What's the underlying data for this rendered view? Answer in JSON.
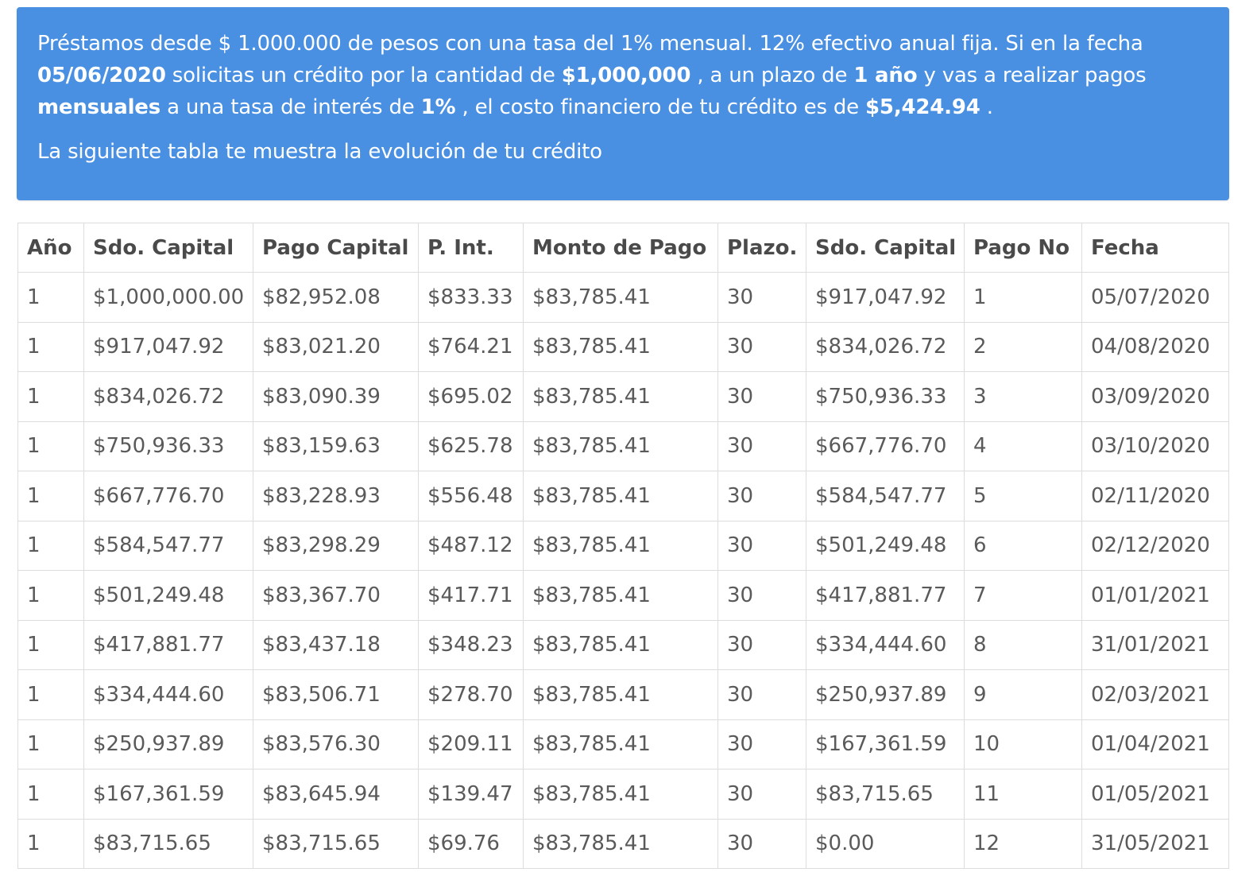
{
  "info": {
    "p1": "Préstamos desde $ 1.000.000 de pesos con una tasa del 1% mensual. 12% efectivo anual fija. Si en la fecha ",
    "date": "05/06/2020",
    "p2": " solicitas un crédito por la cantidad de ",
    "amount": "$1,000,000",
    "p3": " , a un plazo de ",
    "term": "1 año",
    "p4": " y vas a realizar pagos ",
    "frequency": "mensuales",
    "p5": " a una tasa de interés de ",
    "rate": "1%",
    "p6": " , el costo financiero de tu crédito es de ",
    "cost": "$5,424.94",
    "p7": " .",
    "subtitle": "La siguiente tabla te muestra la evolución de tu crédito"
  },
  "table": {
    "headers": [
      "Año",
      "Sdo. Capital",
      "Pago Capital",
      "P. Int.",
      "Monto de Pago",
      "Plazo.",
      "Sdo. Capital",
      "Pago No",
      "Fecha"
    ],
    "rows": [
      [
        "1",
        "$1,000,000.00",
        "$82,952.08",
        "$833.33",
        "$83,785.41",
        "30",
        "$917,047.92",
        "1",
        "05/07/2020"
      ],
      [
        "1",
        "$917,047.92",
        "$83,021.20",
        "$764.21",
        "$83,785.41",
        "30",
        "$834,026.72",
        "2",
        "04/08/2020"
      ],
      [
        "1",
        "$834,026.72",
        "$83,090.39",
        "$695.02",
        "$83,785.41",
        "30",
        "$750,936.33",
        "3",
        "03/09/2020"
      ],
      [
        "1",
        "$750,936.33",
        "$83,159.63",
        "$625.78",
        "$83,785.41",
        "30",
        "$667,776.70",
        "4",
        "03/10/2020"
      ],
      [
        "1",
        "$667,776.70",
        "$83,228.93",
        "$556.48",
        "$83,785.41",
        "30",
        "$584,547.77",
        "5",
        "02/11/2020"
      ],
      [
        "1",
        "$584,547.77",
        "$83,298.29",
        "$487.12",
        "$83,785.41",
        "30",
        "$501,249.48",
        "6",
        "02/12/2020"
      ],
      [
        "1",
        "$501,249.48",
        "$83,367.70",
        "$417.71",
        "$83,785.41",
        "30",
        "$417,881.77",
        "7",
        "01/01/2021"
      ],
      [
        "1",
        "$417,881.77",
        "$83,437.18",
        "$348.23",
        "$83,785.41",
        "30",
        "$334,444.60",
        "8",
        "31/01/2021"
      ],
      [
        "1",
        "$334,444.60",
        "$83,506.71",
        "$278.70",
        "$83,785.41",
        "30",
        "$250,937.89",
        "9",
        "02/03/2021"
      ],
      [
        "1",
        "$250,937.89",
        "$83,576.30",
        "$209.11",
        "$83,785.41",
        "30",
        "$167,361.59",
        "10",
        "01/04/2021"
      ],
      [
        "1",
        "$167,361.59",
        "$83,645.94",
        "$139.47",
        "$83,785.41",
        "30",
        "$83,715.65",
        "11",
        "01/05/2021"
      ],
      [
        "1",
        "$83,715.65",
        "$83,715.65",
        "$69.76",
        "$83,785.41",
        "30",
        "$0.00",
        "12",
        "31/05/2021"
      ]
    ]
  }
}
